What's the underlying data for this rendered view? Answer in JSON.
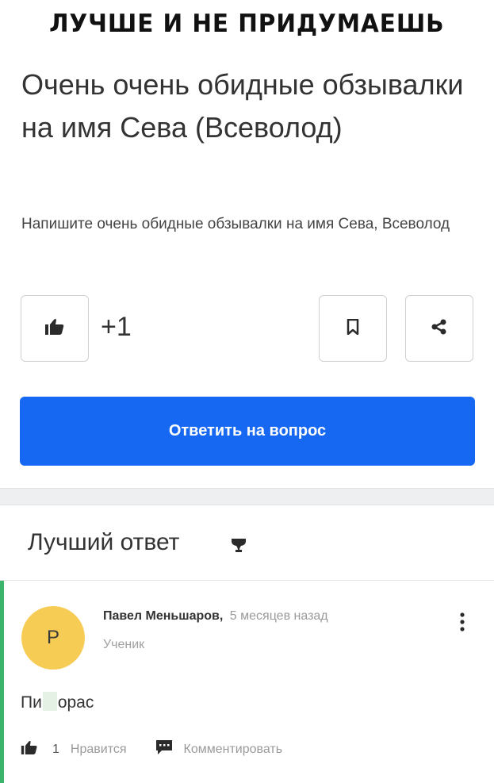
{
  "meme": {
    "caption": "ЛУЧШЕ И НЕ ПРИДУМАЕШЬ"
  },
  "question": {
    "title": "Очень очень обидные обзывалки на имя Сева (Всеволод)",
    "description": "Напишите очень обидные обзывалки на имя Сева, Всеволод",
    "like_count": "+1",
    "answer_button_label": "Ответить на вопрос"
  },
  "best_answer": {
    "heading": "Лучший ответ",
    "author": {
      "avatar_letter": "P",
      "name": "Павел Меньшаров,",
      "time": "5 месяцев назад",
      "rank": "Ученик"
    },
    "text_start": "Пи",
    "text_end": "орас",
    "likes": "1",
    "like_label": "Нравится",
    "comment_label": "Комментировать"
  },
  "colors": {
    "primary_button": "#1668f2",
    "avatar": "#f7cc55",
    "best_answer_accent": "#3cb46c"
  },
  "icons": [
    "thumbs-up-icon",
    "bookmark-icon",
    "share-icon",
    "trophy-icon",
    "more-vertical-icon",
    "comment-icon"
  ]
}
